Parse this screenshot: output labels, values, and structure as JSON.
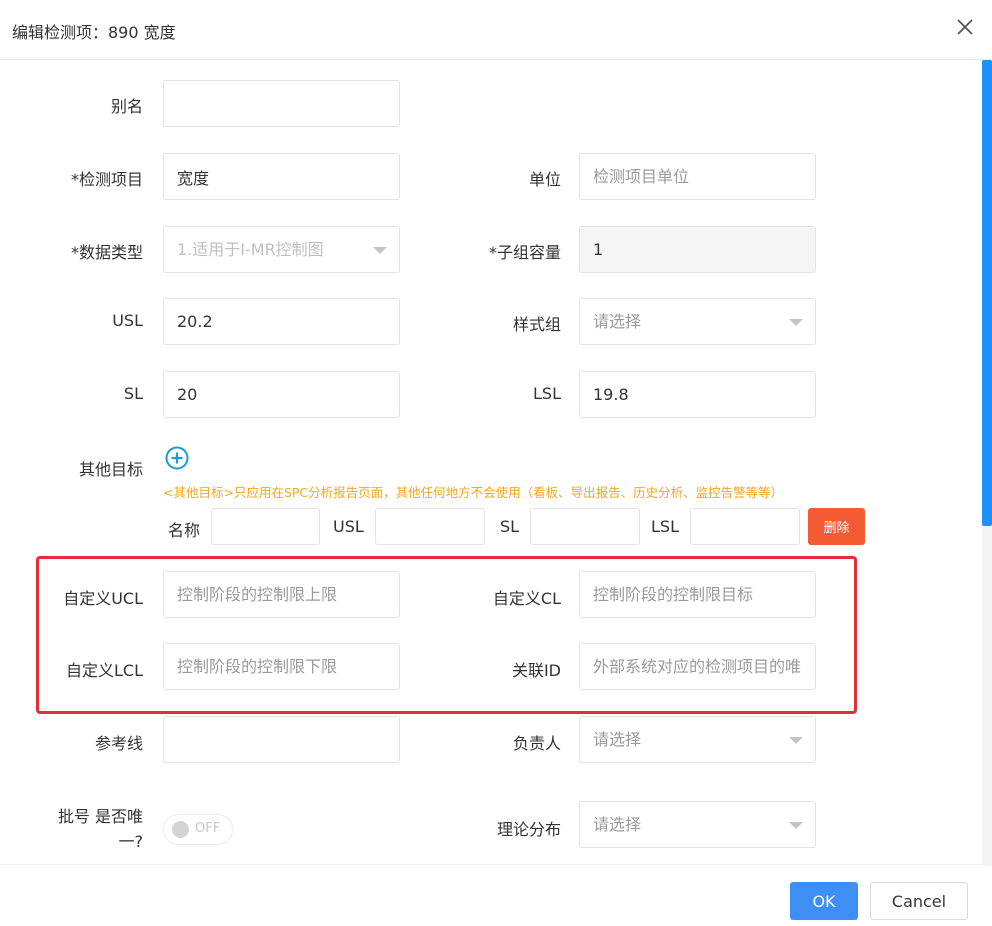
{
  "dialog": {
    "title": "编辑检测项：890 宽度",
    "close_icon": "close-icon",
    "accent_color": "#3d8ef5",
    "highlight_color": "#e0303c"
  },
  "form": {
    "alias": {
      "label": "别名",
      "value": ""
    },
    "inspection_item": {
      "label": "*检测项目",
      "value": "宽度"
    },
    "unit": {
      "label": "单位",
      "placeholder": "检测项目单位",
      "value": ""
    },
    "data_type": {
      "label": "*数据类型",
      "value": "1.适用于I-MR控制图"
    },
    "subgroup_size": {
      "label": "*子组容量",
      "value": "1"
    },
    "usl": {
      "label": "USL",
      "value": "20.2"
    },
    "style_group": {
      "label": "样式组",
      "placeholder": "请选择"
    },
    "sl": {
      "label": "SL",
      "value": "20"
    },
    "lsl": {
      "label": "LSL",
      "value": "19.8"
    },
    "other_targets": {
      "label": "其他目标",
      "add_icon": "plus-circle-icon",
      "hint": "<其他目标>只应用在SPC分析报告页面，其他任何地方不会使用（看板、导出报告、历史分析、监控告警等等）",
      "row": {
        "name_label": "名称",
        "usl_label": "USL",
        "sl_label": "SL",
        "lsl_label": "LSL",
        "delete_label": "删除"
      }
    },
    "custom_ucl": {
      "label": "自定义UCL",
      "placeholder": "控制阶段的控制限上限"
    },
    "custom_cl": {
      "label": "自定义CL",
      "placeholder": "控制阶段的控制限目标"
    },
    "custom_lcl": {
      "label": "自定义LCL",
      "placeholder": "控制阶段的控制限下限"
    },
    "related_id": {
      "label": "关联ID",
      "placeholder": "外部系统对应的检测项目的唯一标识"
    },
    "reference_line": {
      "label": "参考线",
      "value": ""
    },
    "owner": {
      "label": "负责人",
      "placeholder": "请选择"
    },
    "batch_unique": {
      "label_line1": "批号 是否唯",
      "label_line2": "一?",
      "toggle_state": "OFF"
    },
    "distribution": {
      "label": "理论分布",
      "placeholder": "请选择"
    }
  },
  "footer": {
    "ok_label": "OK",
    "cancel_label": "Cancel"
  }
}
